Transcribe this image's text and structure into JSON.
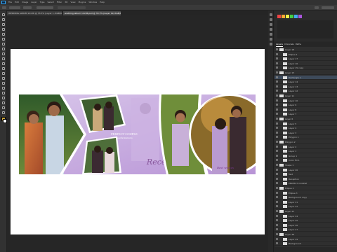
{
  "app": {
    "menu": [
      "File",
      "Edit",
      "Image",
      "Layer",
      "Type",
      "Select",
      "Filter",
      "3D",
      "View",
      "Plugins",
      "Window",
      "Help"
    ]
  },
  "tabs": [
    {
      "label": "WEDDING ALBUM 12x36 @ 33.3% (Layer 1, RGB/8)",
      "active": false
    },
    {
      "label": "wedding album 12x36.psd @ 33.3% (Layer 19, RGB/8)",
      "active": true
    }
  ],
  "album": {
    "couple_text_line1": "PERFECT COUPLE",
    "couple_text_line2": "beautiful memories",
    "script_title": "Reception",
    "caption_small": "Best wishes",
    "colors": {
      "accent": "#c6a7df",
      "frame": "#ffffff",
      "script": "#8a5a9e"
    }
  },
  "layers_panel": {
    "tabs": [
      {
        "label": "Layers",
        "active": true
      },
      {
        "label": "Channels",
        "active": false
      },
      {
        "label": "Paths",
        "active": false
      }
    ],
    "rows": [
      "Layer 18",
      "Ellipse 1",
      "Layer 17",
      "Layer 16",
      "Layer 15 copy",
      "Layer 15",
      "Rectangle 1",
      "Layer 14",
      "Layer 13",
      "Layer 12",
      "Layer 11",
      "Layer 10",
      "Layer 9",
      "Layer 8",
      "Layer 7",
      "Layer 6",
      "Layer 5",
      "Layer 4",
      "Layer 3",
      "Polygon 1",
      "Polygon 2",
      "Layer 2",
      "Layer 1",
      "Group 1",
      "Color Fill 1",
      "Shape 1",
      "Layer 20",
      "Text",
      "Reception",
      "PERFECT COUPLE",
      "Ellipse 2",
      "Ellipse 3",
      "Background copy",
      "Layer 21",
      "Layer 22",
      "Layer 23",
      "Layer 24",
      "Layer 25",
      "Layer 26",
      "Layer 27",
      "Layer 28",
      "Layer 29",
      "Background"
    ]
  }
}
